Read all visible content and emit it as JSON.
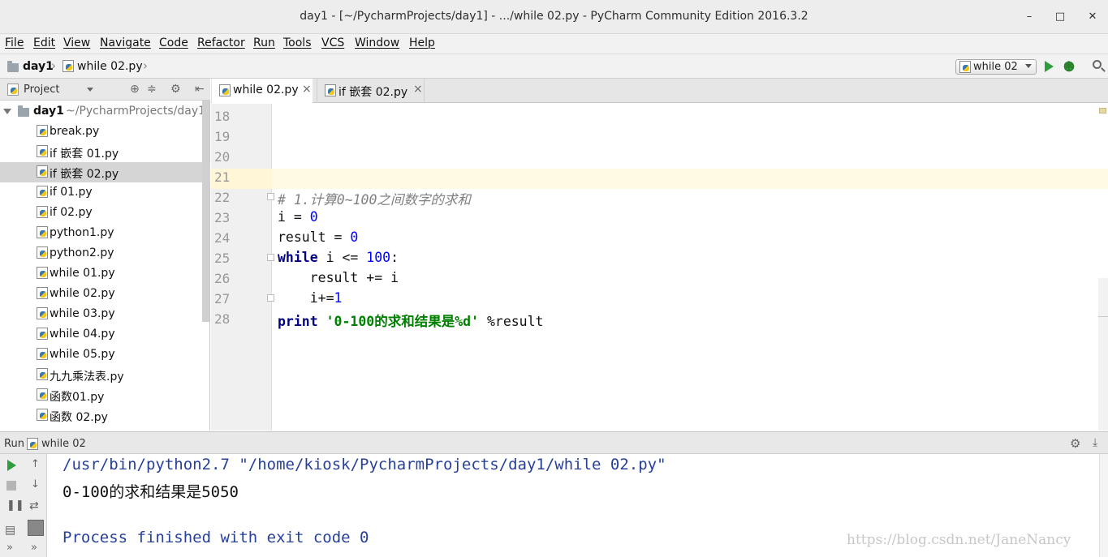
{
  "window": {
    "title": "day1 - [~/PycharmProjects/day1] - .../while 02.py - PyCharm Community Edition 2016.3.2",
    "minimize": "–",
    "maximize": "□",
    "close": "✕"
  },
  "menu": [
    "File",
    "Edit",
    "View",
    "Navigate",
    "Code",
    "Refactor",
    "Run",
    "Tools",
    "VCS",
    "Window",
    "Help"
  ],
  "breadcrumb": {
    "root": "day1",
    "file": "while 02.py"
  },
  "run_config": {
    "label": "while 02"
  },
  "project": {
    "header": "Project",
    "root_name": "day1",
    "root_path": "~/PycharmProjects/day1",
    "files": [
      "break.py",
      "if 嵌套 01.py",
      "if 嵌套 02.py",
      "if 01.py",
      "if 02.py",
      "python1.py",
      "python2.py",
      "while 01.py",
      "while 02.py",
      "while 03.py",
      "while 04.py",
      "while 05.py",
      "九九乘法表.py",
      "函数01.py",
      "函数 02.py"
    ],
    "selected_file": "if 嵌套 02.py"
  },
  "tabs": [
    {
      "label": "while 02.py",
      "active": true
    },
    {
      "label": "if 嵌套 02.py",
      "active": false
    }
  ],
  "editor": {
    "line_numbers": [
      "18",
      "19",
      "20",
      "21",
      "22",
      "23",
      "24",
      "25",
      "26",
      "27",
      "28"
    ],
    "current_line": "21",
    "code": {
      "l22_comment": "# 1.计算0~100之间数字的求和",
      "l23_var": "i",
      "l23_op": " = ",
      "l23_val": "0",
      "l24_var": "result",
      "l24_op": " = ",
      "l24_val": "0",
      "l25_kw": "while",
      "l25_cond": " i <= ",
      "l25_val": "100",
      "l25_end": ":",
      "l26_stmt": "    result += i",
      "l27_stmt": "    i+=",
      "l27_val": "1",
      "l28_kw": "print",
      "l28_str": " '0-100的求和结果是%d'",
      "l28_rest": " %result"
    }
  },
  "run": {
    "label": "Run",
    "config": "while 02",
    "console": {
      "command": "/usr/bin/python2.7 \"/home/kiosk/PycharmProjects/day1/while 02.py\"",
      "output": "0-100的求和结果是5050",
      "finished": "Process finished with exit code 0"
    },
    "watermark": "https://blog.csdn.net/JaneNancy"
  },
  "colors": {
    "keyword": "#000080",
    "number": "#0000ff",
    "string": "#008000",
    "comment": "#808080",
    "console_command": "#27409a",
    "current_line": "#fffae3"
  }
}
